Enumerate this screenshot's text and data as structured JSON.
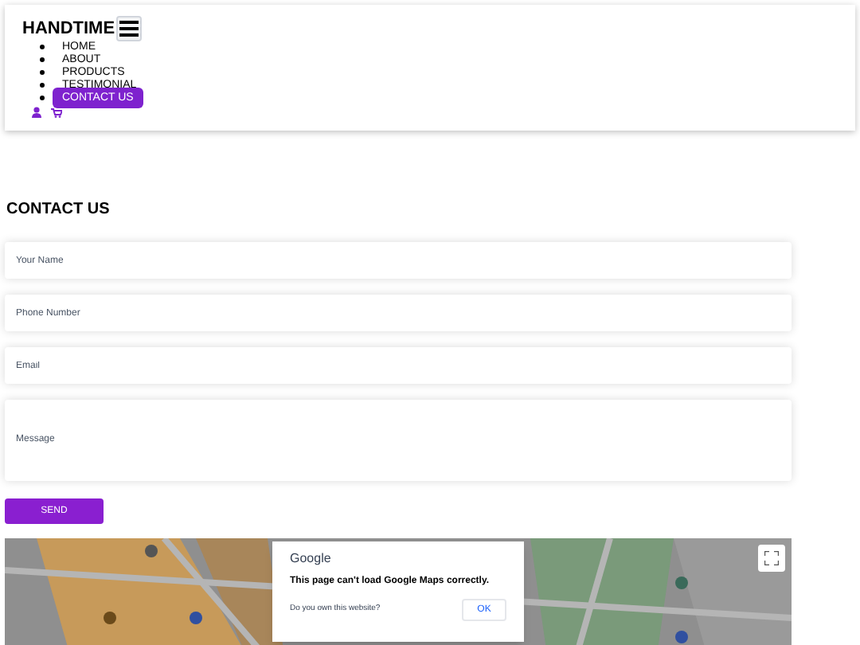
{
  "brand": "HANDTIME",
  "nav": [
    {
      "label": "HOME",
      "selected": false
    },
    {
      "label": "ABOUT",
      "selected": false
    },
    {
      "label": "PRODUCTS",
      "selected": false
    },
    {
      "label": "TESTIMONIAL",
      "selected": false
    },
    {
      "label": "CONTACT US",
      "selected": true
    }
  ],
  "heading": "CONTACT US",
  "form": {
    "fields": [
      {
        "placeholder": "Your Name",
        "kind": "input"
      },
      {
        "placeholder": "Phone Number",
        "kind": "input"
      },
      {
        "placeholder": "Email",
        "kind": "input"
      },
      {
        "placeholder": "Message",
        "kind": "textarea"
      }
    ],
    "submit": "SEND"
  },
  "map": {
    "dialog": {
      "title": "Google",
      "message": "This page can't load Google Maps correctly.",
      "question": "Do you own this website?",
      "button": "OK"
    }
  }
}
